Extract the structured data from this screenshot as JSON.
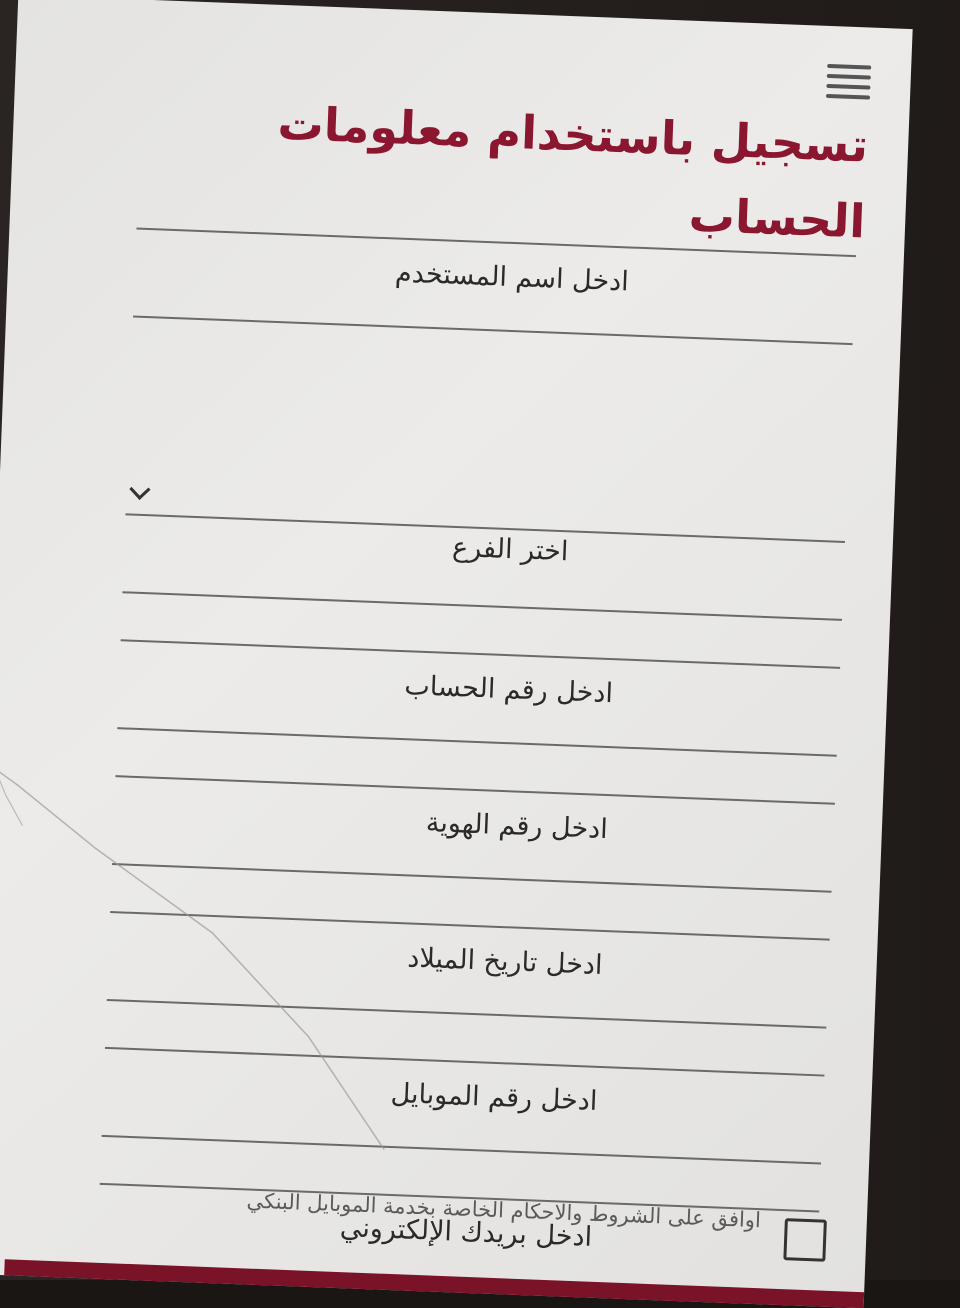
{
  "header": {
    "menu_icon": "hamburger-menu-icon",
    "title": "تسجيل باستخدام معلومات الحساب"
  },
  "form": {
    "fields": [
      {
        "label": "ادخل اسم المستخدم"
      },
      {
        "label": "اختر الفرع",
        "dropdown_icon": "chevron-down-icon"
      },
      {
        "label": "ادخل رقم الحساب"
      },
      {
        "label": "ادخل رقم الهوية"
      },
      {
        "label": "ادخل تاريخ الميلاد"
      },
      {
        "label": "ادخل رقم الموبايل"
      },
      {
        "label": "ادخل بريدك الإلكتروني"
      }
    ],
    "terms": {
      "checked": false,
      "text": "اوافق على الشروط والاحكام الخاصة بخدمة الموبايل البنكي"
    }
  },
  "colors": {
    "title": "#8a1630",
    "submit_button": "#7a1228",
    "background": "#e8e7e5"
  }
}
